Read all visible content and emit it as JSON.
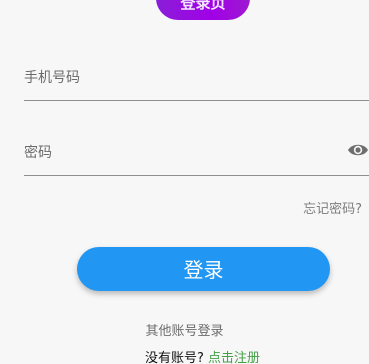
{
  "logo": {
    "text": "登录页"
  },
  "form": {
    "phone_placeholder": "手机号码",
    "password_placeholder": "密码",
    "forgot_label": "忘记密码?",
    "login_label": "登录"
  },
  "footer": {
    "other_login_label": "其他账号登录",
    "no_account_label": "没有账号?",
    "register_label": "点击注册"
  },
  "icons": {
    "password_toggle": "eye-icon"
  },
  "colors": {
    "primary_button": "#2196f3",
    "register_link": "#43a047",
    "logo_gradient": "#9a12dc"
  }
}
